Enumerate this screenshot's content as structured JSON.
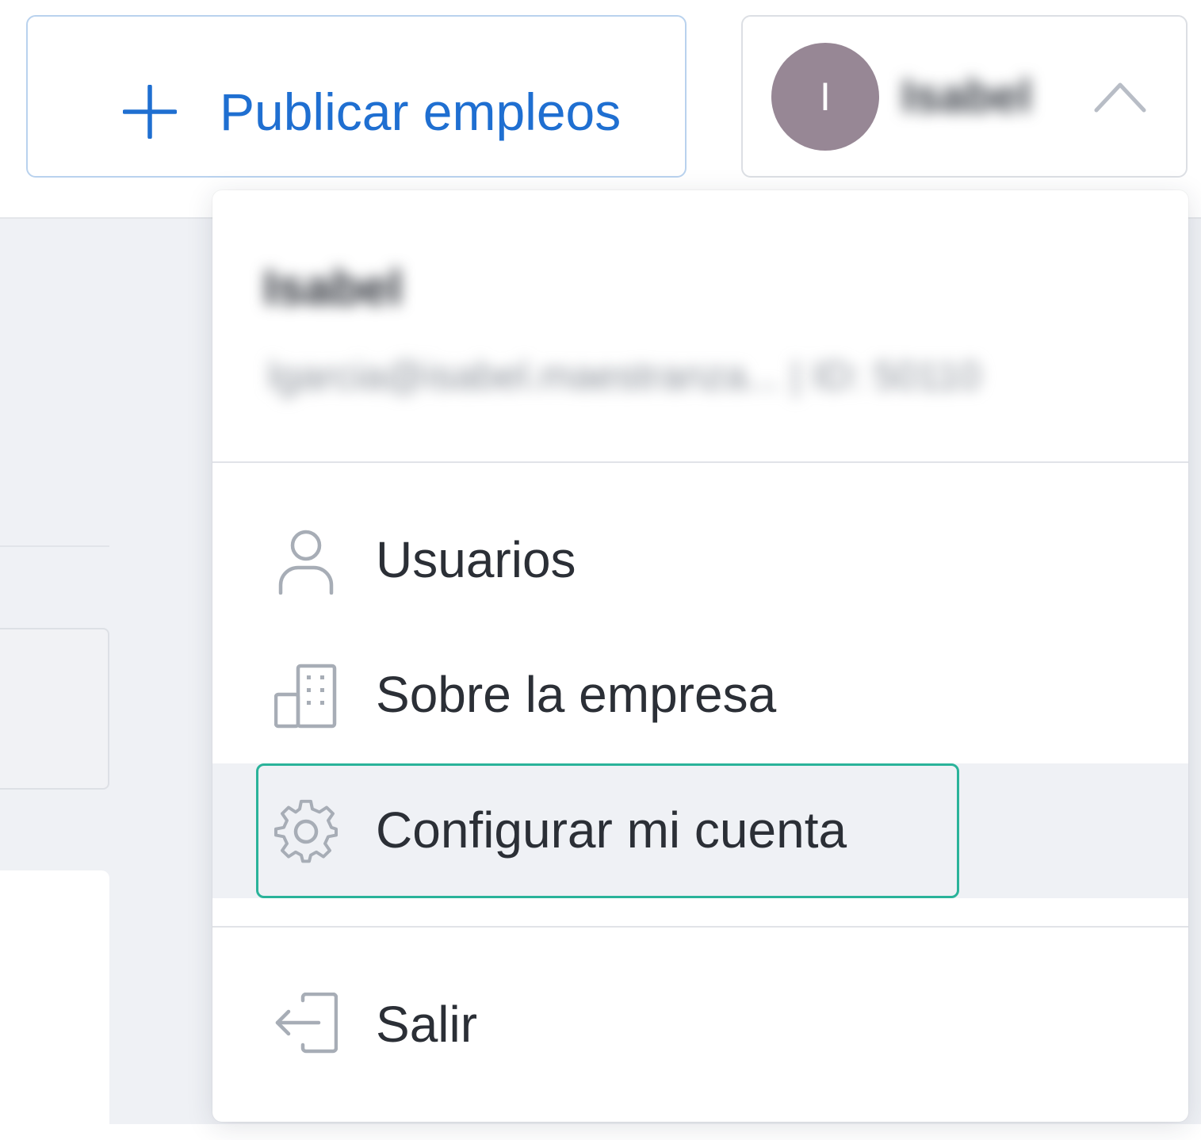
{
  "header": {
    "publish_button": {
      "label": "Publicar empleos",
      "icon": "plus-icon",
      "color": "#1f6fd1"
    },
    "user_menu": {
      "avatar_initial": "I",
      "username": "Isabel",
      "chevron": "chevron-up-icon",
      "avatar_color": "#978795"
    }
  },
  "dropdown": {
    "user_name": "Isabel",
    "user_email_and_id": "lgarcia@isabel.maestranza... | ID: 50110",
    "items": [
      {
        "label": "Usuarios",
        "icon": "user-icon"
      },
      {
        "label": "Sobre la empresa",
        "icon": "building-icon"
      },
      {
        "label": "Configurar mi cuenta",
        "icon": "gear-icon",
        "highlighted": true
      },
      {
        "label": "Salir",
        "icon": "logout-icon"
      }
    ],
    "focus_color": "#2ab39a"
  }
}
